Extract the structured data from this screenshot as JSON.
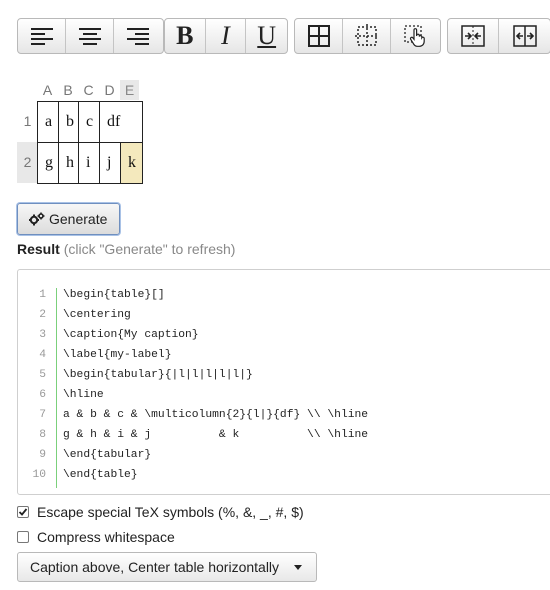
{
  "toolbar": {
    "groups": [
      [
        "align-left-icon",
        "align-center-icon",
        "align-right-icon"
      ],
      [
        "bold-icon",
        "italic-icon",
        "underline-icon"
      ],
      [
        "all-borders-icon",
        "no-borders-icon",
        "border-select-icon"
      ],
      [
        "merge-horizontal-icon",
        "split-vertical-icon"
      ]
    ],
    "bold_label": "B",
    "italic_label": "I",
    "underline_label": "U"
  },
  "grid": {
    "columns": [
      "A",
      "B",
      "C",
      "D",
      "E"
    ],
    "rows": [
      "1",
      "2"
    ],
    "row1": [
      "a",
      "b",
      "c",
      "df"
    ],
    "row2": [
      "g",
      "h",
      "i",
      "j",
      "k"
    ],
    "selected_cell": "E2",
    "selected_fill": "#f4e9bd"
  },
  "generate_button": {
    "label": "Generate",
    "icon": "gears-icon"
  },
  "result": {
    "title": "Result",
    "hint": "(click \"Generate\" to refresh)"
  },
  "code": {
    "lines": [
      "\\begin{table}[]",
      "\\centering",
      "\\caption{My caption}",
      "\\label{my-label}",
      "\\begin{tabular}{|l|l|l|l|l|}",
      "\\hline",
      "a & b & c & \\multicolumn{2}{l|}{df} \\\\ \\hline",
      "g & h & i & j          & k          \\\\ \\hline",
      "\\end{tabular}",
      "\\end{table}"
    ],
    "line_numbers": [
      "1",
      "2",
      "3",
      "4",
      "5",
      "6",
      "7",
      "8",
      "9",
      "10"
    ]
  },
  "options": {
    "escape_label": "Escape special TeX symbols (%, &, _, #, $)",
    "escape_checked": true,
    "compress_label": "Compress whitespace",
    "compress_checked": false
  },
  "dropdown": {
    "selected": "Caption above, Center table horizontally"
  }
}
